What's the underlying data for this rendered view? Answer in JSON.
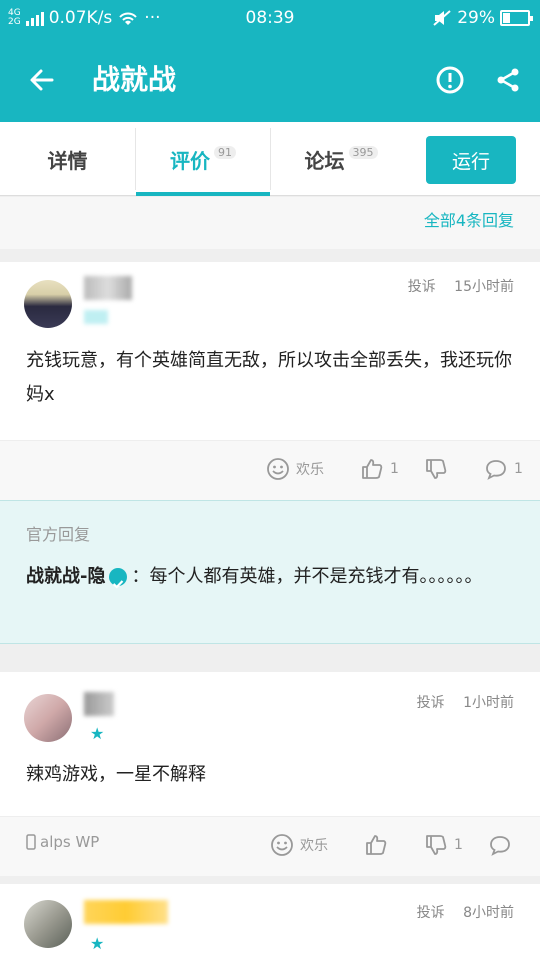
{
  "status_bar": {
    "network_type_top": "4G",
    "network_type_bottom": "2G",
    "speed": "0.07K/s",
    "more": "···",
    "time": "08:39",
    "battery_percent": "29%",
    "battery_level": 0.29
  },
  "appbar": {
    "title": "战就战"
  },
  "tabs": [
    {
      "label": "详情",
      "badge": ""
    },
    {
      "label": "评价",
      "badge": "91"
    },
    {
      "label": "论坛",
      "badge": "395"
    }
  ],
  "run_button": "运行",
  "all_replies": "全部4条回复",
  "reviews": [
    {
      "report": "投诉",
      "time": "15小时前",
      "text": "充钱玩意，有个英雄简直无敌，所以攻击全部丢失，我还玩你妈x",
      "reaction": "欢乐",
      "likes": "1",
      "dislikes": "",
      "comments": "1",
      "device": ""
    },
    {
      "report": "投诉",
      "time": "1小时前",
      "text": "辣鸡游戏，一星不解释",
      "reaction": "欢乐",
      "likes": "",
      "dislikes": "1",
      "comments": "",
      "device": "alps WP"
    },
    {
      "report": "投诉",
      "time": "8小时前"
    }
  ],
  "official_reply": {
    "label": "官方回复",
    "user": "战就战-隐",
    "text": "：每个人都有英雄，并不是充钱才有。。。。。。"
  },
  "colors": {
    "accent": "#18b6c1",
    "official_bg": "#e6f6f6"
  },
  "icons": [
    "back-arrow-icon",
    "report-icon",
    "share-icon",
    "smile-icon",
    "thumb-up-icon",
    "thumb-down-icon",
    "comment-icon",
    "star-icon",
    "verified-icon",
    "phone-icon"
  ]
}
